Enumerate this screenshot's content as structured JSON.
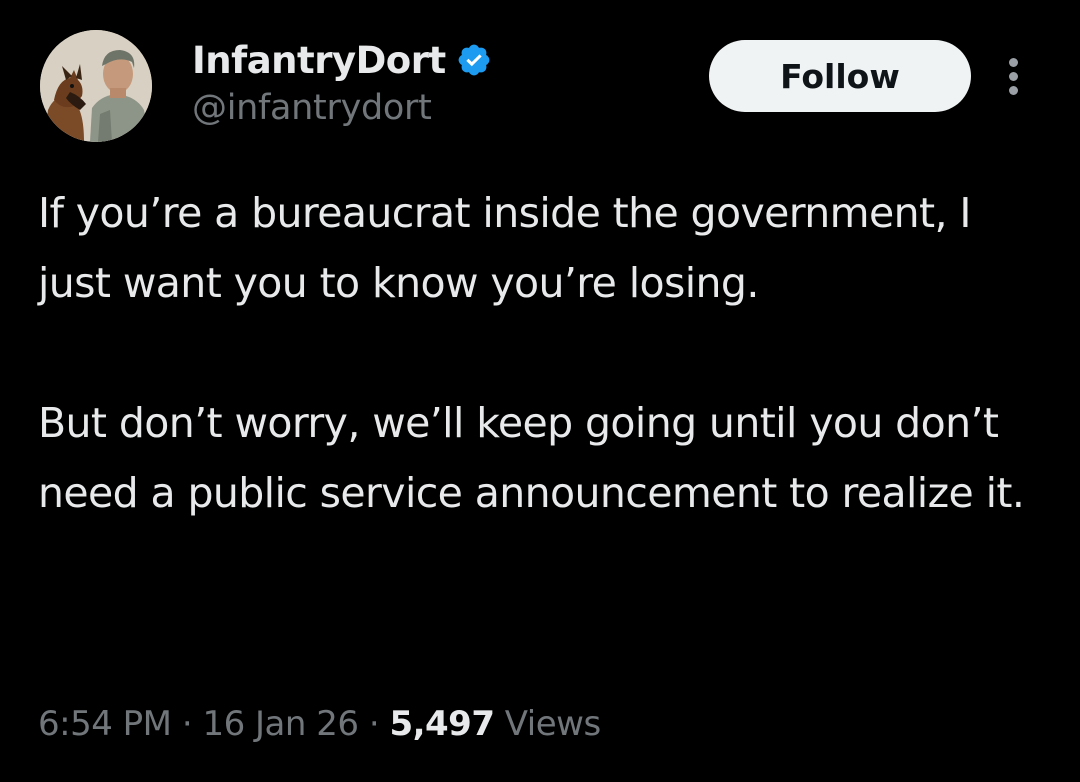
{
  "tweet": {
    "author": {
      "display_name": "InfantryDort",
      "handle": "@infantrydort",
      "verified": true,
      "verified_color": "#1d9bf0"
    },
    "follow_label": "Follow",
    "text_paragraphs": [
      "If you’re a bureaucrat inside the government, I just want you to know you’re losing.",
      "But don’t worry, we’ll keep going until you don’t need a public service announcement to realize it."
    ],
    "meta": {
      "time": "6:54 PM",
      "separator": "·",
      "date": "16 Jan 26",
      "views_count": "5,497",
      "views_label": "Views"
    }
  },
  "icons": {
    "verified": "verified-badge-icon",
    "more": "more-options-icon"
  },
  "colors": {
    "background": "#000000",
    "primary_text": "#e7e9ea",
    "secondary_text": "#71767b",
    "follow_bg": "#eff3f4"
  }
}
